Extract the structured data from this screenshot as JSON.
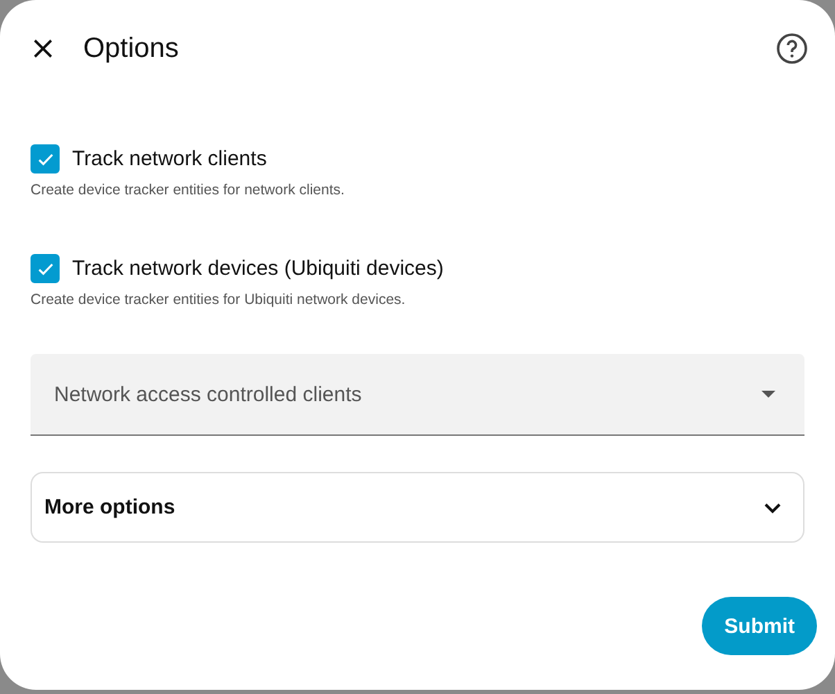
{
  "dialog": {
    "title": "Options",
    "options": [
      {
        "label": "Track network clients",
        "description": "Create device tracker entities for network clients.",
        "checked": true
      },
      {
        "label": "Track network devices (Ubiquiti devices)",
        "description": "Create device tracker entities for Ubiquiti network devices.",
        "checked": true
      }
    ],
    "select": {
      "placeholder": "Network access controlled clients"
    },
    "expander": {
      "label": "More options",
      "expanded": false
    },
    "buttons": [
      "Submit"
    ]
  }
}
